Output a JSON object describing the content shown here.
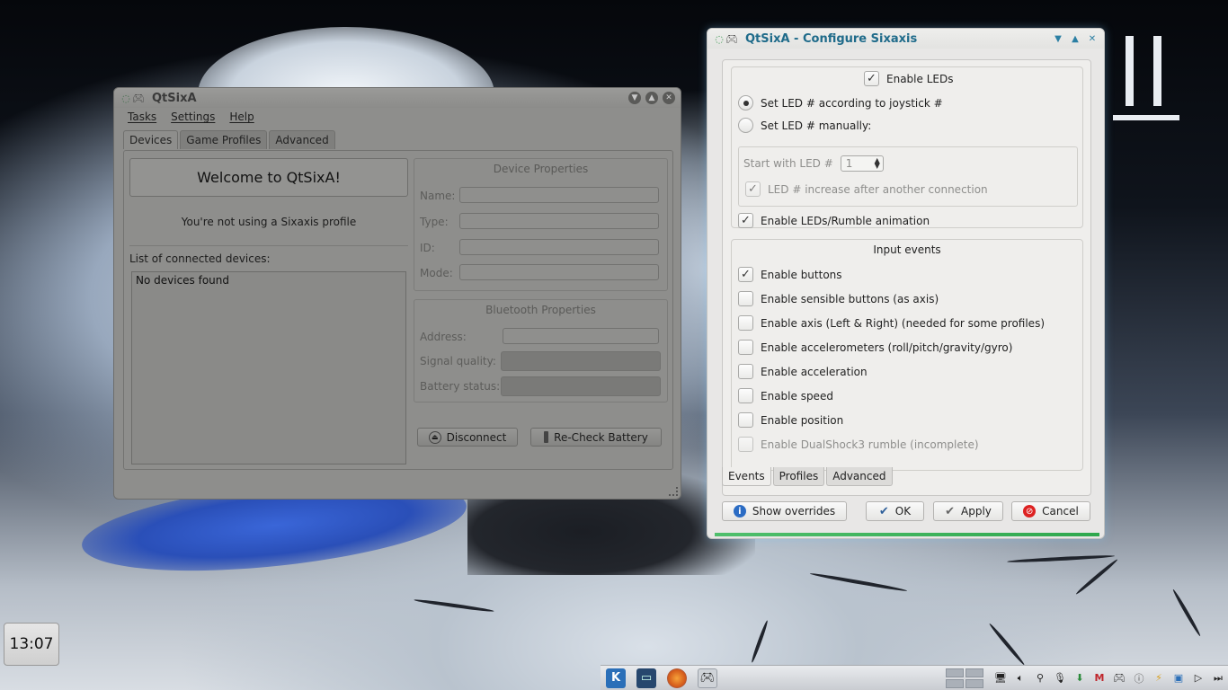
{
  "main_window": {
    "title": "QtSixA",
    "menu": [
      "Tasks",
      "Settings",
      "Help"
    ],
    "tabs": [
      "Devices",
      "Game Profiles",
      "Advanced"
    ],
    "welcome": "Welcome to QtSixA!",
    "profile_status": "You're not using a Sixaxis profile",
    "list_label": "List of connected devices:",
    "devices_empty": "No devices found",
    "device_properties": {
      "title": "Device Properties",
      "labels": [
        "Name:",
        "Type:",
        "ID:",
        "Mode:"
      ]
    },
    "bluetooth_properties": {
      "title": "Bluetooth Properties",
      "labels": [
        "Address:",
        "Signal quality:",
        "Battery status:"
      ]
    },
    "buttons": {
      "disconnect": "Disconnect",
      "recheck_battery": "Re-Check Battery"
    }
  },
  "config_window": {
    "title": "QtSixA - Configure Sixaxis",
    "leds": {
      "enable_leds": {
        "label": "Enable LEDs",
        "checked": true
      },
      "radio_joystick": {
        "label": "Set LED # according to joystick #",
        "selected": true
      },
      "radio_manual": {
        "label": "Set LED # manually:",
        "selected": false
      },
      "start_with_label": "Start with LED #",
      "start_with_value": "1",
      "increase": {
        "label": "LED # increase after another connection",
        "checked": true
      },
      "animation": {
        "label": "Enable LEDs/Rumble animation",
        "checked": true
      }
    },
    "input_events": {
      "title": "Input events",
      "options": [
        {
          "label": "Enable buttons",
          "checked": true
        },
        {
          "label": "Enable sensible buttons (as axis)",
          "checked": false
        },
        {
          "label": "Enable axis (Left & Right) (needed for some profiles)",
          "checked": false
        },
        {
          "label": "Enable accelerometers (roll/pitch/gravity/gyro)",
          "checked": false
        },
        {
          "label": "Enable acceleration",
          "checked": false
        },
        {
          "label": "Enable speed",
          "checked": false
        },
        {
          "label": "Enable position",
          "checked": false
        },
        {
          "label": "Enable DualShock3 rumble (incomplete)",
          "checked": false
        }
      ]
    },
    "tabs": [
      "Events",
      "Profiles",
      "Advanced"
    ],
    "buttons": {
      "show_overrides": "Show overrides",
      "ok": "OK",
      "apply": "Apply",
      "cancel": "Cancel"
    }
  },
  "clock": {
    "time": "13:07"
  }
}
